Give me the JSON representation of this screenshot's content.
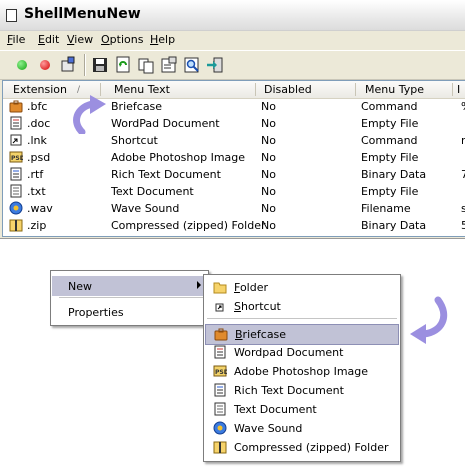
{
  "window": {
    "title": "ShellMenuNew"
  },
  "menubar": [
    {
      "label": "File",
      "hot": "F",
      "rest": "ile"
    },
    {
      "label": "Edit",
      "hot": "E",
      "rest": "dit"
    },
    {
      "label": "View",
      "hot": "V",
      "rest": "iew"
    },
    {
      "label": "Options",
      "hot": "O",
      "rest": "ptions"
    },
    {
      "label": "Help",
      "hot": "H",
      "rest": "elp"
    }
  ],
  "toolbar": {
    "enable_icon": "green-dot-icon",
    "disable_icon": "red-dot-icon",
    "settings_icon": "properties-icon",
    "save_icon": "save-icon",
    "refresh_icon": "refresh-icon",
    "copy_icon": "copy-icon",
    "properties_icon": "properties-icon",
    "find_icon": "find-icon",
    "exit_icon": "exit-icon"
  },
  "columns": [
    "Extension",
    "Menu Text",
    "Disabled",
    "Menu Type",
    "I"
  ],
  "rows": [
    {
      "ext": ".bfc",
      "menu_text": "Briefcase",
      "disabled": "No",
      "type": "Command",
      "extra": "%",
      "icon": "briefcase-icon"
    },
    {
      "ext": ".doc",
      "menu_text": "WordPad Document",
      "disabled": "No",
      "type": "Empty File",
      "extra": "",
      "icon": "document-icon"
    },
    {
      "ext": ".lnk",
      "menu_text": "Shortcut",
      "disabled": "No",
      "type": "Command",
      "extra": "r",
      "icon": "shortcut-icon"
    },
    {
      "ext": ".psd",
      "menu_text": "Adobe Photoshop Image",
      "disabled": "No",
      "type": "Empty File",
      "extra": "",
      "icon": "psd-icon"
    },
    {
      "ext": ".rtf",
      "menu_text": "Rich Text Document",
      "disabled": "No",
      "type": "Binary Data",
      "extra": "7",
      "icon": "rtf-icon"
    },
    {
      "ext": ".txt",
      "menu_text": "Text Document",
      "disabled": "No",
      "type": "Empty File",
      "extra": "",
      "icon": "text-icon"
    },
    {
      "ext": ".wav",
      "menu_text": "Wave Sound",
      "disabled": "No",
      "type": "Filename",
      "extra": "s",
      "icon": "wave-icon"
    },
    {
      "ext": ".zip",
      "menu_text": "Compressed (zipped) Folder",
      "disabled": "No",
      "type": "Binary Data",
      "extra": "5",
      "icon": "zip-icon"
    }
  ],
  "context_menu": {
    "items": [
      "New",
      "Properties"
    ]
  },
  "new_submenu": {
    "top_items": [
      {
        "label": "Folder",
        "hot": "F",
        "rest": "older",
        "icon": "folder-icon"
      },
      {
        "label": "Shortcut",
        "hot": "S",
        "rest": "hortcut",
        "icon": "shortcut-icon"
      }
    ],
    "items": [
      {
        "label": "Briefcase",
        "hot": "B",
        "rest": "riefcase",
        "icon": "briefcase-icon"
      },
      {
        "label": "Wordpad Document",
        "icon": "document-icon"
      },
      {
        "label": "Adobe Photoshop Image",
        "icon": "psd-icon"
      },
      {
        "label": "Rich Text Document",
        "icon": "rtf-icon"
      },
      {
        "label": "Text Document",
        "icon": "text-icon"
      },
      {
        "label": "Wave Sound",
        "icon": "wave-icon"
      },
      {
        "label": "Compressed (zipped) Folder",
        "icon": "zip-icon"
      }
    ]
  },
  "colors": {
    "arrow": "#9b8fe0",
    "highlight": "#c1c2d6"
  }
}
